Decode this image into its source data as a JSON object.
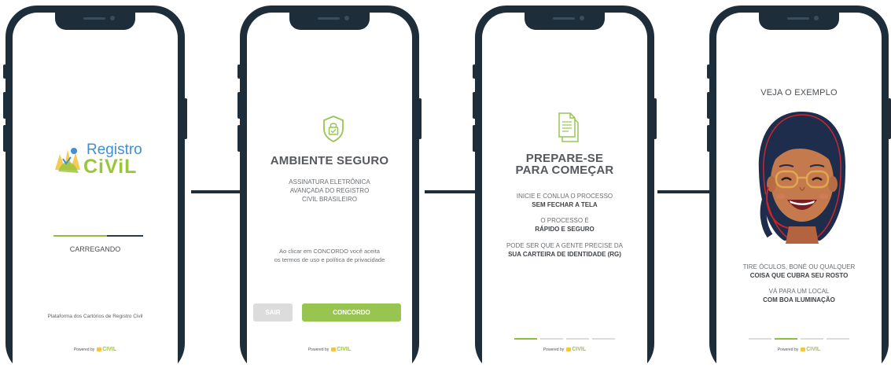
{
  "screen1": {
    "logo_line1": "Registro",
    "logo_line2": "CiViL",
    "loading_label": "CARREGANDO",
    "loading_progress": 0.6,
    "platform_text": "Plataforma dos Cartórios de Registro Civil",
    "powered_by": "Powered by",
    "powered_brand": "CIVIL"
  },
  "screen2": {
    "title": "AMBIENTE SEGURO",
    "subtitle": [
      "ASSINATURA ELETRÔNICA",
      "AVANÇADA DO REGISTRO",
      "CIVIL BRASILEIRO"
    ],
    "terms": [
      "Ao clicar em CONCORDO você aceita",
      "os termos de uso e política de privacidade"
    ],
    "exit_label": "SAIR",
    "agree_label": "CONCORDO",
    "powered_by": "Powered by",
    "powered_brand": "CIVIL",
    "shield_icon": "shield-lock-icon"
  },
  "screen3": {
    "title_line1": "PREPARE-SE",
    "title_line2": "PARA COMEÇAR",
    "p1_line1": "INICIE E CONLUA O PROCESSO",
    "p1_line2": "SEM FECHAR A TELA",
    "p2_line1": "O PROCESSO É",
    "p2_line2": "RÁPIDO E SEGURO",
    "p3_line1": "PODE SER QUE A GENTE PRECISE DA",
    "p3_line2": "SUA CARTEIRA DE IDENTIDADE (RG)",
    "step_active": 1,
    "steps": 4,
    "powered_by": "Powered by",
    "powered_brand": "CIVIL",
    "document_icon": "document-icon"
  },
  "screen4": {
    "title": "VEJA O EXEMPLO",
    "p1_line1": "TIRE ÓCULOS, BONÉ OU QUALQUER",
    "p1_line2": "COISA QUE CUBRA SEU ROSTO",
    "p2_line1": "VÁ PARA UM LOCAL",
    "p2_line2": "COM BOA ILUMINAÇÃO",
    "step_active": 2,
    "steps": 4,
    "powered_by": "Powered by",
    "powered_brand": "CIVIL",
    "illustration": "woman-with-glasses-avatar"
  },
  "colors": {
    "frame": "#1d2d3a",
    "accent_green": "#97c550",
    "logo_blue": "#3f8fd1",
    "text_dark": "#55595d"
  }
}
